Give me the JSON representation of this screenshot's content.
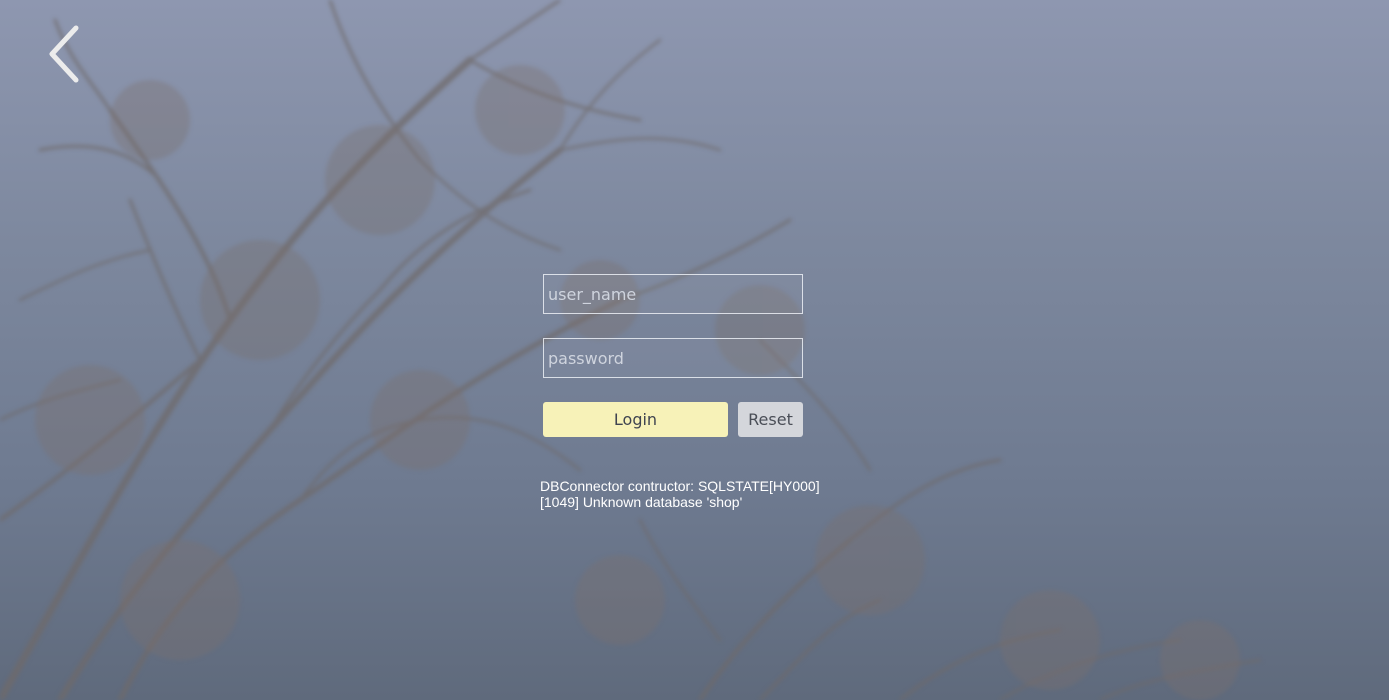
{
  "nav": {
    "back_icon": "chevron-left-icon"
  },
  "login": {
    "username_placeholder": "user_name",
    "password_placeholder": "password",
    "login_label": "Login",
    "reset_label": "Reset"
  },
  "error": {
    "message": "DBConnector contructor: SQLSTATE[HY000] [1049] Unknown database 'shop'"
  },
  "colors": {
    "login_button": "#f7f2b8",
    "reset_button": "#d4d6db",
    "field_border": "#ebeef5",
    "error_text": "#ffffff"
  }
}
